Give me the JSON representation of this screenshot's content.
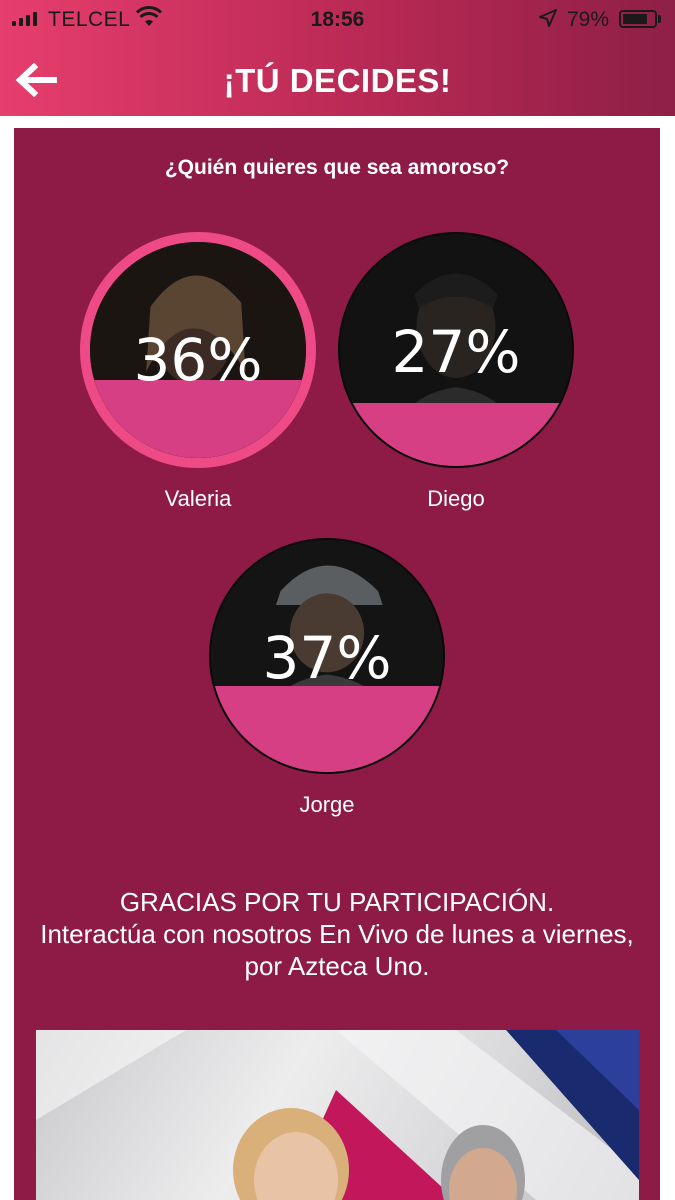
{
  "status_bar": {
    "carrier": "TELCEL",
    "time": "18:56",
    "battery_percent_label": "79%",
    "battery_level": 0.79
  },
  "nav": {
    "title": "¡TÚ DECIDES!",
    "back_icon": "arrow-left-icon"
  },
  "poll": {
    "question": "¿Quién quieres que sea amoroso?",
    "candidates": [
      {
        "name": "Valeria",
        "percent_label": "36%",
        "percent": 36,
        "selected": true
      },
      {
        "name": "Diego",
        "percent_label": "27%",
        "percent": 27,
        "selected": false
      },
      {
        "name": "Jorge",
        "percent_label": "37%",
        "percent": 37,
        "selected": false
      }
    ]
  },
  "thanks": {
    "line1": "GRACIAS POR TU PARTICIPACIÓN.",
    "line2": "Interactúa con nosotros En Vivo de lunes a viernes, por Azteca Uno."
  },
  "colors": {
    "header_start": "#e63e6d",
    "header_end": "#8e1f46",
    "card_bg": "#8e1b45",
    "vote_fill": "#d73f84",
    "selected_ring": "#ee4a86"
  }
}
